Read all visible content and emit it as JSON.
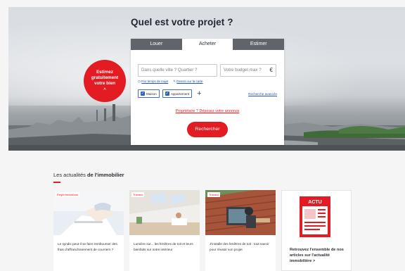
{
  "hero": {
    "title": "Quel est votre projet ?",
    "badge": {
      "line1": "Estimez",
      "line2": "gratuitement",
      "line3": "votre bien",
      "chevron": "^"
    }
  },
  "search": {
    "tabs": [
      {
        "label": "Louer",
        "active": false
      },
      {
        "label": "Acheter",
        "active": true
      },
      {
        "label": "Estimer",
        "active": false
      }
    ],
    "city_placeholder": "Dans quelle ville ? Quartier ?",
    "budget_placeholder": "Votre budget max ?",
    "currency": "€",
    "link_travel_time": "Par temps de trajet",
    "link_draw_map": "Dessin sur la carte",
    "chip_house": "Maison",
    "chip_apartment": "Appartement",
    "plus": "+",
    "advanced_search": "Recherche avancée",
    "owner_link": "Propriétaire ? Déposez votre annonce",
    "submit": "Rechercher"
  },
  "news": {
    "title_regular": "Les actualités ",
    "title_bold": "de l'immobilier",
    "articles": [
      {
        "tag": "Réglementations",
        "text": "Le syndic peut-il se faire rembourser des frais d'affranchissement de courriers ?"
      },
      {
        "tag": "Travaux",
        "text": "Lumière sur... les fenêtres de toit et leurs bienfaits sur notre intérieur"
      },
      {
        "tag": "Travaux",
        "text": "J'installe des fenêtres de toit : tout savoir pour réussir son projet"
      }
    ],
    "more": {
      "illustration_label": "ACTU",
      "text": "Retrouvez l'ensemble de nos articles sur l'actualité immobilière",
      "chevron": ">"
    }
  },
  "colors": {
    "accent": "#e31b23",
    "tab_dark": "#60656b",
    "link": "#2456a6"
  }
}
